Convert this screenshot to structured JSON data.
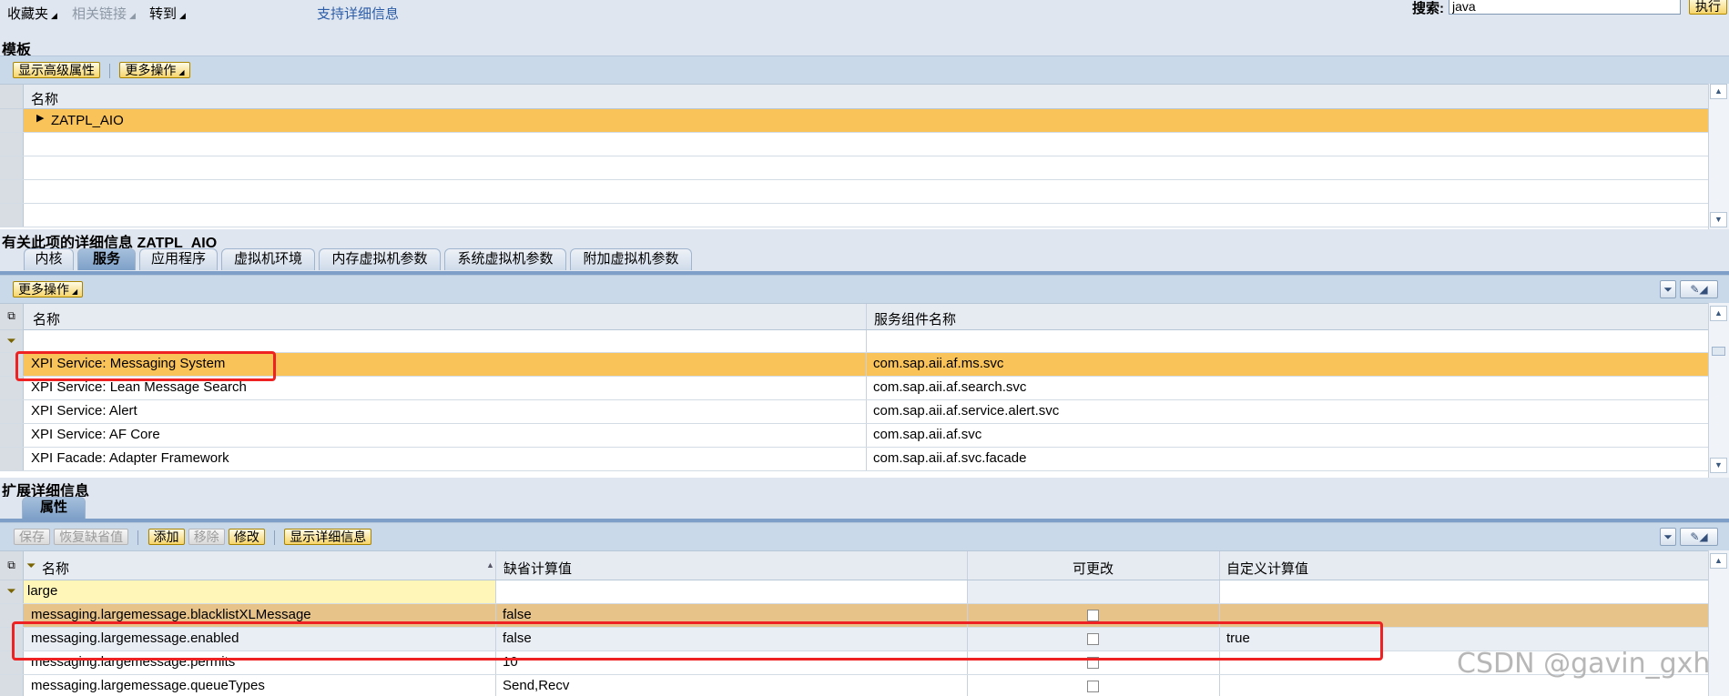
{
  "topbar": {
    "favorites": "收藏夹",
    "related_links": "相关链接",
    "goto": "转到",
    "support_details": "支持详细信息",
    "search_label": "搜索:",
    "search_value": "java",
    "execute": "执行"
  },
  "template_section": {
    "title": "模板",
    "buttons": {
      "show_advanced": "显示高级属性",
      "more_actions": "更多操作"
    },
    "column_name": "名称",
    "rows": [
      "ZATPL_AIO"
    ]
  },
  "details_section": {
    "title": "有关此项的详细信息 ZATPL_AIO",
    "tabs": [
      "内核",
      "服务",
      "应用程序",
      "虚拟机环境",
      "内存虚拟机参数",
      "系统虚拟机参数",
      "附加虚拟机参数"
    ],
    "active_tab": "服务",
    "more_actions": "更多操作",
    "columns": {
      "name": "名称",
      "component": "服务组件名称"
    },
    "rows": [
      {
        "name": "XPI Service: Messaging System",
        "component": "com.sap.aii.af.ms.svc"
      },
      {
        "name": "XPI Service: Lean Message Search",
        "component": "com.sap.aii.af.search.svc"
      },
      {
        "name": "XPI Service: Alert",
        "component": "com.sap.aii.af.service.alert.svc"
      },
      {
        "name": "XPI Service: AF Core",
        "component": "com.sap.aii.af.svc"
      },
      {
        "name": "XPI Facade: Adapter Framework",
        "component": "com.sap.aii.af.svc.facade"
      }
    ]
  },
  "extended_section": {
    "title": "扩展详细信息",
    "tab": "属性",
    "buttons": {
      "save": "保存",
      "restore_default": "恢复缺省值",
      "add": "添加",
      "remove": "移除",
      "modify": "修改",
      "show_details": "显示详细信息"
    },
    "columns": {
      "name": "名称",
      "default_value": "缺省计算值",
      "modifiable": "可更改",
      "custom_value": "自定义计算值"
    },
    "filter_value": "large",
    "rows": [
      {
        "name": "messaging.largemessage.blacklistXLMessage",
        "default": "false",
        "custom": ""
      },
      {
        "name": "messaging.largemessage.enabled",
        "default": "false",
        "custom": "true"
      },
      {
        "name": "messaging.largemessage.permits",
        "default": "10",
        "custom": ""
      },
      {
        "name": "messaging.largemessage.queueTypes",
        "default": "Send,Recv",
        "custom": ""
      }
    ]
  },
  "watermark": "CSDN @gavin_gxh"
}
